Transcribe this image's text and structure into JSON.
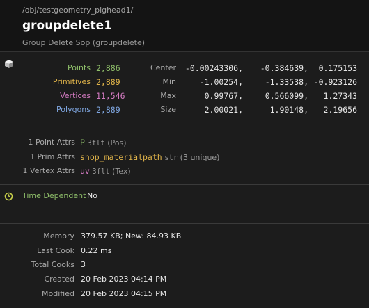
{
  "header": {
    "path": "/obj/testgeometry_pighead1/",
    "node_name": "groupdelete1",
    "node_type": "Group Delete Sop (groupdelete)"
  },
  "counts": [
    {
      "label": "Points",
      "value": "2,886",
      "color": "#8fbf6a"
    },
    {
      "label": "Primitives",
      "value": "2,889",
      "color": "#e0b44a"
    },
    {
      "label": "Vertices",
      "value": "11,546",
      "color": "#d27ac0"
    },
    {
      "label": "Polygons",
      "value": "2,889",
      "color": "#7fa6e0"
    }
  ],
  "bounds": [
    {
      "label": "Center",
      "x": "-0.00243306,",
      "y": "-0.384639,",
      "z": "0.175153"
    },
    {
      "label": "Min",
      "x": "-1.00254,",
      "y": "-1.33538,",
      "z": "-0.923126"
    },
    {
      "label": "Max",
      "x": "0.99767,",
      "y": "0.566099,",
      "z": "1.27343"
    },
    {
      "label": "Size",
      "x": "2.00021,",
      "y": "1.90148,",
      "z": "2.19656"
    }
  ],
  "attributes": [
    {
      "label": "1 Point Attrs",
      "name": "P",
      "name_color": "#8fbf6a",
      "type": "3flt",
      "desc": "(Pos)"
    },
    {
      "label": "1 Prim Attrs",
      "name": "shop_materialpath",
      "name_color": "#e0b44a",
      "type": "str",
      "desc": "(3 unique)"
    },
    {
      "label": "1 Vertex Attrs",
      "name": "uv",
      "name_color": "#d27ac0",
      "type": "3flt",
      "desc": "(Tex)"
    }
  ],
  "time_dependent": {
    "label": "Time Dependent",
    "value": "No"
  },
  "info": [
    {
      "label": "Memory",
      "value": "379.57 KB; New: 84.93 KB"
    },
    {
      "label": "Last Cook",
      "value": "0.22 ms"
    },
    {
      "label": "Total Cooks",
      "value": "3"
    },
    {
      "label": "Created",
      "value": "20 Feb 2023 04:14 PM"
    },
    {
      "label": "Modified",
      "value": "20 Feb 2023 04:15 PM"
    }
  ],
  "icons": {
    "geometry": "cube-icon",
    "time": "clock-icon"
  }
}
